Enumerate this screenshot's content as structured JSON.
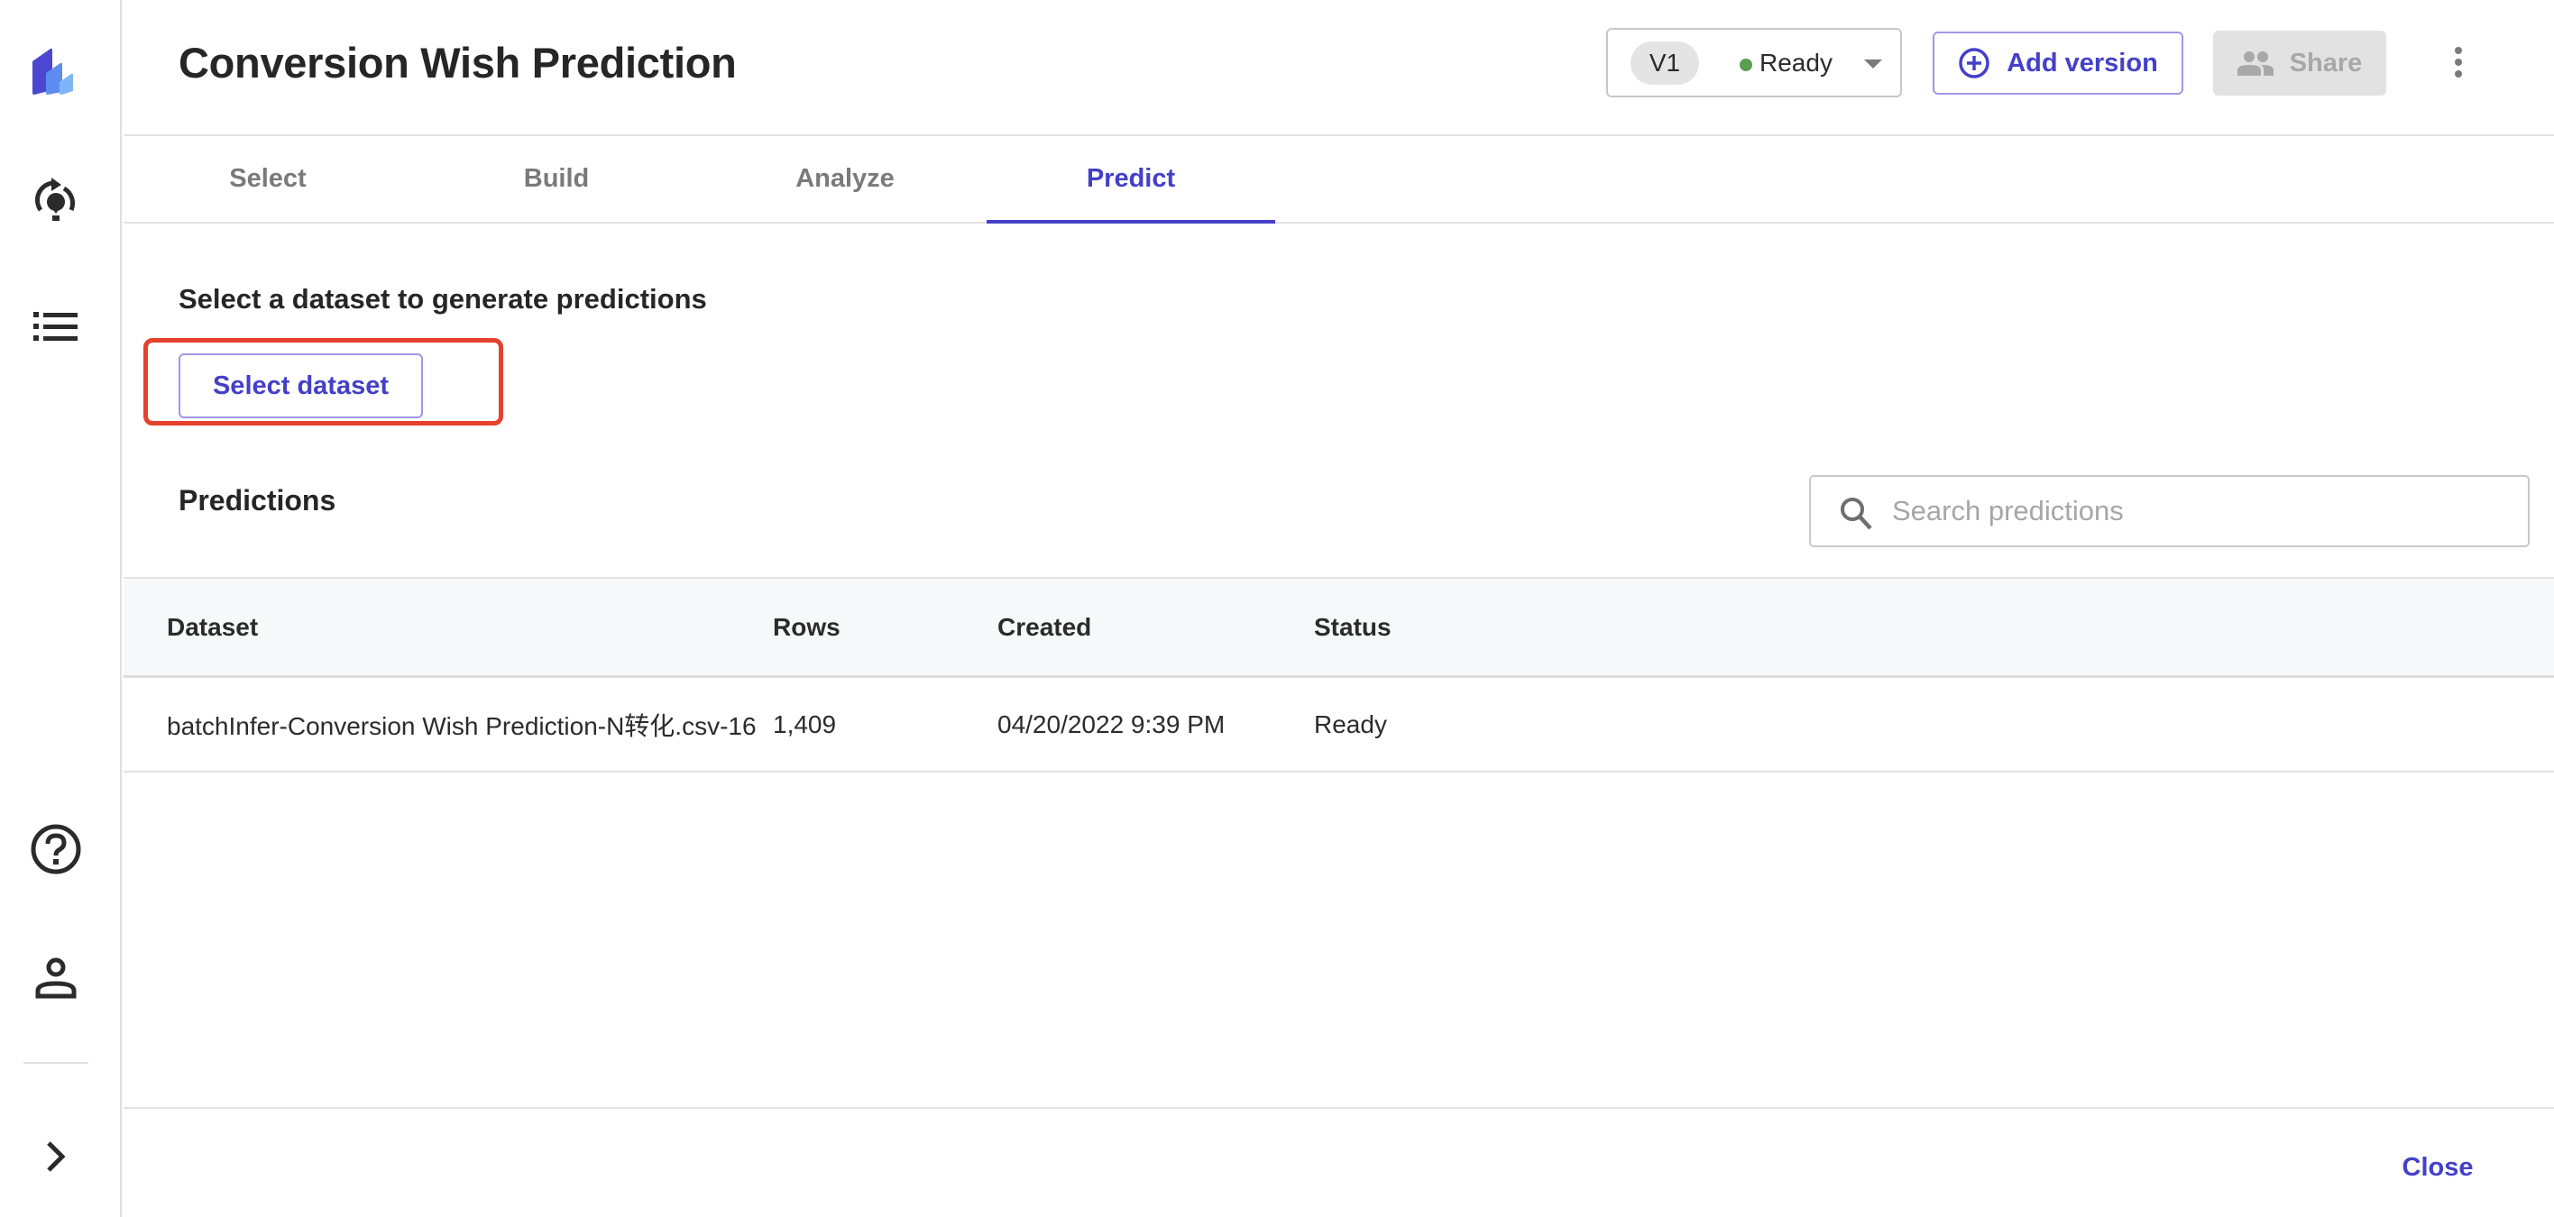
{
  "app": {
    "title": "Conversion Wish Prediction",
    "brand_colors": {
      "accent": "#4440c8",
      "logo_dark": "#4b47d0",
      "logo_mid": "#5e8cf0",
      "logo_light": "#7fb4f8",
      "highlight": "#e6412c",
      "ready_dot": "#5a9e52"
    }
  },
  "sidebar": {
    "items": [
      {
        "icon": "logo-icon"
      },
      {
        "icon": "refresh-lightbulb-icon"
      },
      {
        "icon": "list-icon"
      },
      {
        "icon": "help-icon"
      },
      {
        "icon": "user-icon"
      },
      {
        "icon": "chevron-right-icon"
      }
    ]
  },
  "header": {
    "version": {
      "label": "V1",
      "status": "Ready"
    },
    "add_version_label": "Add version",
    "share_label": "Share",
    "more_icon": "more-vertical-icon"
  },
  "tabs": [
    {
      "label": "Select",
      "active": false
    },
    {
      "label": "Build",
      "active": false
    },
    {
      "label": "Analyze",
      "active": false
    },
    {
      "label": "Predict",
      "active": true
    }
  ],
  "predict": {
    "heading": "Select a dataset to generate predictions",
    "select_dataset_label": "Select dataset",
    "predictions_heading": "Predictions",
    "search": {
      "placeholder": "Search predictions",
      "value": ""
    },
    "table": {
      "columns": [
        "Dataset",
        "Rows",
        "Created",
        "Status"
      ],
      "rows": [
        {
          "dataset": "batchInfer-Conversion Wish Prediction-N转化.csv-16",
          "rows": "1,409",
          "created": "04/20/2022 9:39 PM",
          "status": "Ready"
        }
      ]
    }
  },
  "footer": {
    "close_label": "Close"
  }
}
